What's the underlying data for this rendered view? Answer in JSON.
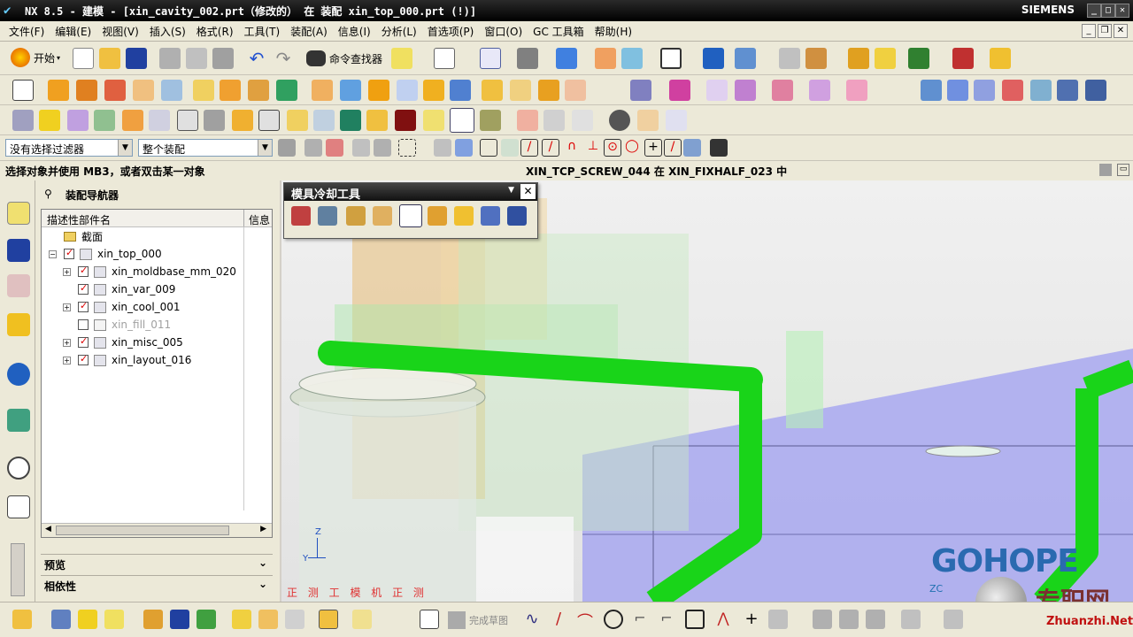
{
  "window": {
    "title": "NX 8.5 - 建模 - [xin_cavity_002.prt（修改的） 在 装配 xin_top_000.prt  (!)]",
    "brand": "SIEMENS"
  },
  "menu": [
    "文件(F)",
    "编辑(E)",
    "视图(V)",
    "插入(S)",
    "格式(R)",
    "工具(T)",
    "装配(A)",
    "信息(I)",
    "分析(L)",
    "首选项(P)",
    "窗口(O)",
    "GC 工具箱",
    "帮助(H)"
  ],
  "toolbar": {
    "start_label": "开始",
    "command_finder_label": "命令查找器",
    "filter_value": "没有选择过滤器",
    "scope_value": "整个装配",
    "finish_sketch_label": "完成草图"
  },
  "status": {
    "prompt": "选择对象并使用 MB3，或者双击某一对象",
    "context": "XIN_TCP_SCREW_044 在 XIN_FIXHALF_023 中"
  },
  "navigator": {
    "title": "装配导航器",
    "col_name": "描述性部件名",
    "col_info": "信息",
    "rows": [
      {
        "label": "截面",
        "checked": false,
        "expander": "",
        "indent": 0,
        "greyed": false
      },
      {
        "label": "xin_top_000",
        "checked": true,
        "expander": "−",
        "indent": 0,
        "greyed": false
      },
      {
        "label": "xin_moldbase_mm_020",
        "checked": true,
        "expander": "+",
        "indent": 1,
        "greyed": false
      },
      {
        "label": "xin_var_009",
        "checked": true,
        "expander": "",
        "indent": 1,
        "greyed": false
      },
      {
        "label": "xin_cool_001",
        "checked": true,
        "expander": "+",
        "indent": 1,
        "greyed": false
      },
      {
        "label": "xin_fill_011",
        "checked": false,
        "expander": "",
        "indent": 1,
        "greyed": true
      },
      {
        "label": "xin_misc_005",
        "checked": true,
        "expander": "+",
        "indent": 1,
        "greyed": false
      },
      {
        "label": "xin_layout_016",
        "checked": true,
        "expander": "+",
        "indent": 1,
        "greyed": false
      }
    ],
    "preview_label": "预览",
    "dependency_label": "相依性"
  },
  "palette": {
    "title": "模具冷却工具"
  },
  "viewport": {
    "view_label": "正 测 工 模 机 正 测",
    "axis_z": "Z",
    "axis_y": "Y",
    "axis_zc": "ZC"
  },
  "watermark": {
    "brand": "GOHOPE",
    "site_cn": "专职网",
    "site_en": "Zhuanzhi.Net"
  },
  "colors": {
    "pipe_green": "#19d419",
    "plate_blue": "#a8a8f0",
    "part_orange": "#e8c890"
  }
}
